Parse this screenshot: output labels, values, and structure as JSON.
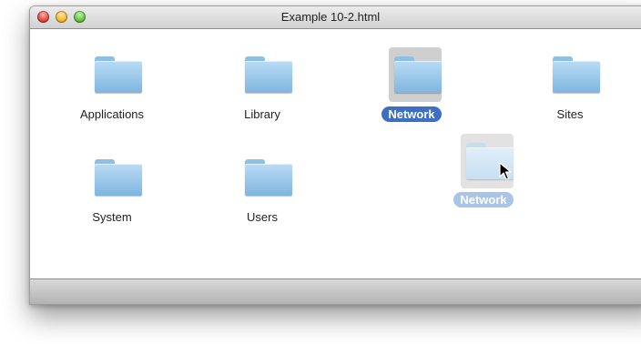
{
  "window": {
    "title": "Example 10-2.html"
  },
  "items": [
    {
      "label": "Applications",
      "icon": "folder-icon",
      "selected": false
    },
    {
      "label": "Library",
      "icon": "folder-icon",
      "selected": false
    },
    {
      "label": "Network",
      "icon": "folder-icon",
      "selected": true
    },
    {
      "label": "Sites",
      "icon": "folder-icon",
      "selected": false
    },
    {
      "label": "System",
      "icon": "folder-icon",
      "selected": false
    },
    {
      "label": "Users",
      "icon": "folder-icon",
      "selected": false
    }
  ],
  "drag_ghost": {
    "label": "Network",
    "icon": "folder-icon"
  },
  "colors": {
    "selection_label": "#3d6fc3",
    "folder_blue": "#7fb5e0"
  }
}
